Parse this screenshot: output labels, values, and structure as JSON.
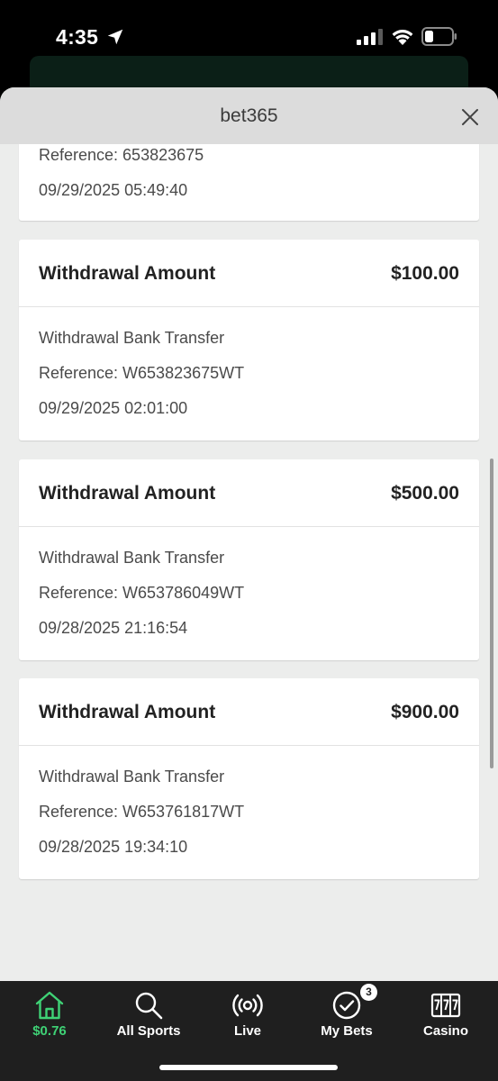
{
  "status_bar": {
    "time": "4:35"
  },
  "sheet": {
    "title": "bet365"
  },
  "partial_card": {
    "reference": "Reference: 653823675",
    "datetime": "09/29/2025 05:49:40"
  },
  "transactions": [
    {
      "title": "Withdrawal Amount",
      "amount": "$100.00",
      "method": "Withdrawal Bank Transfer",
      "reference": "Reference: W653823675WT",
      "datetime": "09/29/2025 02:01:00"
    },
    {
      "title": "Withdrawal Amount",
      "amount": "$500.00",
      "method": "Withdrawal Bank Transfer",
      "reference": "Reference: W653786049WT",
      "datetime": "09/28/2025 21:16:54"
    },
    {
      "title": "Withdrawal Amount",
      "amount": "$900.00",
      "method": "Withdrawal Bank Transfer",
      "reference": "Reference: W653761817WT",
      "datetime": "09/28/2025 19:34:10"
    }
  ],
  "tabbar": {
    "items": [
      {
        "label": "$0.76",
        "icon": "home-icon",
        "active": true
      },
      {
        "label": "All Sports",
        "icon": "search-icon"
      },
      {
        "label": "Live",
        "icon": "live-broadcast-icon"
      },
      {
        "label": "My Bets",
        "icon": "check-circle-icon",
        "badge": "3"
      },
      {
        "label": "Casino",
        "icon": "slot-machine-icon"
      }
    ]
  },
  "colors": {
    "accent": "#3fd276",
    "tabbar_bg": "#1f1f1f",
    "sheet_bg": "#ecedec",
    "header_bg": "#dcdcdc"
  }
}
